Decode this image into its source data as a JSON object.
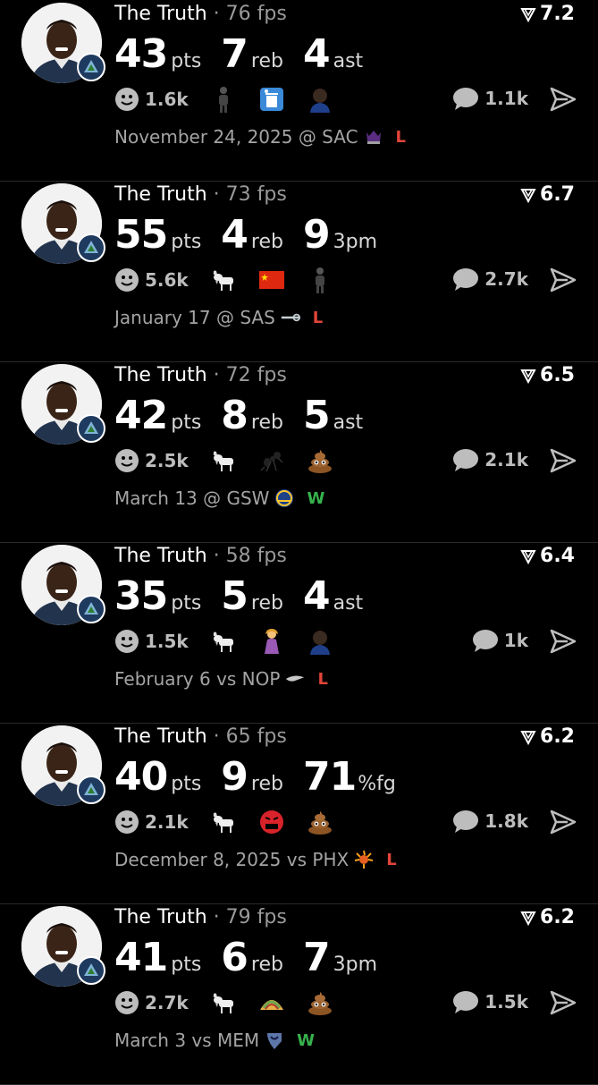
{
  "posts": [
    {
      "author": "The Truth",
      "fps": "76 fps",
      "rating": "7.2",
      "stats": [
        {
          "value": "43",
          "unit": "pts"
        },
        {
          "value": "7",
          "unit": "reb"
        },
        {
          "value": "4",
          "unit": "ast"
        }
      ],
      "likes": "1.6k",
      "reaction_icons": [
        "player-silhouette-icon",
        "trash-can-icon",
        "player-portrait-icon"
      ],
      "comments": "1.1k",
      "game": "November 24, 2025 @ SAC",
      "opponent_logo": "kings-logo-icon",
      "result": "L"
    },
    {
      "author": "The Truth",
      "fps": "73 fps",
      "rating": "6.7",
      "stats": [
        {
          "value": "55",
          "unit": "pts"
        },
        {
          "value": "4",
          "unit": "reb"
        },
        {
          "value": "9",
          "unit": "3pm"
        }
      ],
      "likes": "5.6k",
      "reaction_icons": [
        "goat-icon",
        "china-flag-icon",
        "player-silhouette-icon"
      ],
      "comments": "2.7k",
      "game": "January 17 @ SAS",
      "opponent_logo": "spurs-logo-icon",
      "result": "L"
    },
    {
      "author": "The Truth",
      "fps": "72 fps",
      "rating": "6.5",
      "stats": [
        {
          "value": "42",
          "unit": "pts"
        },
        {
          "value": "8",
          "unit": "reb"
        },
        {
          "value": "5",
          "unit": "ast"
        }
      ],
      "likes": "2.5k",
      "reaction_icons": [
        "goat-icon",
        "ant-icon",
        "poop-icon"
      ],
      "comments": "2.1k",
      "game": "March 13 @ GSW",
      "opponent_logo": "warriors-logo-icon",
      "result": "W"
    },
    {
      "author": "The Truth",
      "fps": "58 fps",
      "rating": "6.4",
      "stats": [
        {
          "value": "35",
          "unit": "pts"
        },
        {
          "value": "5",
          "unit": "reb"
        },
        {
          "value": "4",
          "unit": "ast"
        }
      ],
      "likes": "1.5k",
      "reaction_icons": [
        "goat-icon",
        "woman-emoji-icon",
        "player-portrait-icon"
      ],
      "comments": "1k",
      "game": "February 6 vs NOP",
      "opponent_logo": "pelicans-logo-icon",
      "result": "L"
    },
    {
      "author": "The Truth",
      "fps": "65 fps",
      "rating": "6.2",
      "stats": [
        {
          "value": "40",
          "unit": "pts"
        },
        {
          "value": "9",
          "unit": "reb"
        },
        {
          "value": "71",
          "unit": "%fg"
        }
      ],
      "likes": "2.1k",
      "reaction_icons": [
        "goat-icon",
        "cursing-face-icon",
        "poop-icon"
      ],
      "comments": "1.8k",
      "game": "December 8, 2025 vs PHX",
      "opponent_logo": "suns-logo-icon",
      "result": "L"
    },
    {
      "author": "The Truth",
      "fps": "79 fps",
      "rating": "6.2",
      "stats": [
        {
          "value": "41",
          "unit": "pts"
        },
        {
          "value": "6",
          "unit": "reb"
        },
        {
          "value": "7",
          "unit": "3pm"
        }
      ],
      "likes": "2.7k",
      "reaction_icons": [
        "goat-icon",
        "taco-icon",
        "poop-icon"
      ],
      "comments": "1.5k",
      "game": "March 3 vs MEM",
      "opponent_logo": "grizzlies-logo-icon",
      "result": "W"
    }
  ],
  "colors": {
    "background": "#000000",
    "muted": "#a4a4a4",
    "loss": "#e0453a",
    "win": "#37b24d"
  }
}
